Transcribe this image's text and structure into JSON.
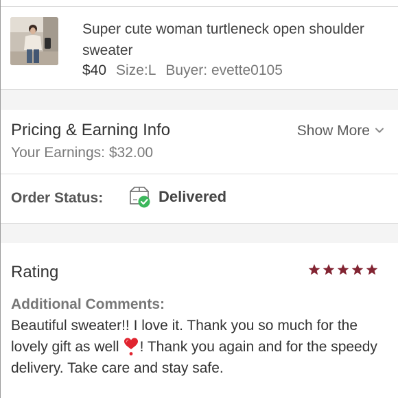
{
  "product": {
    "image_icon": "product-photo-woman-sweater",
    "title": "Super cute woman turtleneck open shoulder sweater",
    "price": "$40",
    "size": "Size:L",
    "buyer": "Buyer: evette0105"
  },
  "pricing": {
    "heading": "Pricing & Earning Info",
    "earnings": "Your Earnings: $32.00",
    "show_more_label": "Show More",
    "show_more_icon": "chevron-down-icon"
  },
  "order_status": {
    "label": "Order Status:",
    "value": "Delivered",
    "icon": "box-delivered-check-icon",
    "check_color": "#3cb75c"
  },
  "rating": {
    "heading": "Rating",
    "stars": 5,
    "max_stars": 5,
    "star_color": "#822432",
    "comments_label": "Additional Comments:",
    "comment_part1": "Beautiful sweater!! I love it. Thank you so much for the lovely gift as well",
    "comment_emoji": "red-heart-exclamation-icon",
    "comment_part2": "! Thank you again and for the speedy delivery. Take care and stay safe."
  }
}
